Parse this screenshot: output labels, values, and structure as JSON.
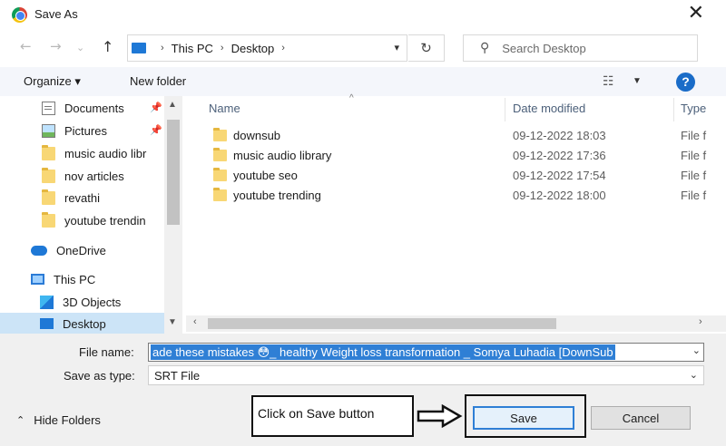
{
  "window": {
    "title": "Save As",
    "close_glyph": "✕"
  },
  "nav": {
    "breadcrumb": [
      "This PC",
      "Desktop"
    ],
    "search_placeholder": "Search Desktop"
  },
  "toolbar": {
    "organize_label": "Organize ▾",
    "new_folder_label": "New folder"
  },
  "sidebar": {
    "items": [
      {
        "label": "Documents",
        "icon": "documents-icon",
        "pinned": true
      },
      {
        "label": "Pictures",
        "icon": "pictures-icon",
        "pinned": true
      },
      {
        "label": "music audio libr",
        "icon": "folder-icon"
      },
      {
        "label": "nov articles",
        "icon": "folder-icon"
      },
      {
        "label": "revathi",
        "icon": "folder-icon"
      },
      {
        "label": "youtube trendin",
        "icon": "folder-icon"
      },
      {
        "label": "OneDrive",
        "icon": "onedrive-icon"
      },
      {
        "label": "This PC",
        "icon": "this-pc-icon"
      },
      {
        "label": "3D Objects",
        "icon": "3d-objects-icon"
      },
      {
        "label": "Desktop",
        "icon": "desktop-icon",
        "selected": true
      }
    ]
  },
  "file_list": {
    "columns": [
      "Name",
      "Date modified",
      "Type"
    ],
    "rows": [
      {
        "name": "downsub",
        "date": "09-12-2022 18:03",
        "type": "File f"
      },
      {
        "name": "music audio library",
        "date": "09-12-2022 17:36",
        "type": "File f"
      },
      {
        "name": "youtube seo",
        "date": "09-12-2022 17:54",
        "type": "File f"
      },
      {
        "name": "youtube trending",
        "date": "09-12-2022 18:00",
        "type": "File f"
      }
    ]
  },
  "form": {
    "file_name_label": "File name:",
    "file_name_value": "ade these mistakes 😳_ healthy Weight loss transformation _ Somya Luhadia [DownSub",
    "save_as_type_label": "Save as type:",
    "save_as_type_value": "SRT File"
  },
  "footer": {
    "hide_folders_label": "Hide Folders",
    "annotation_text": "Click on Save button",
    "save_label": "Save",
    "cancel_label": "Cancel"
  },
  "colors": {
    "accent": "#2f7fd5",
    "selection": "#cce4f7",
    "help": "#1a6cc8",
    "folder": "#f8d775"
  }
}
